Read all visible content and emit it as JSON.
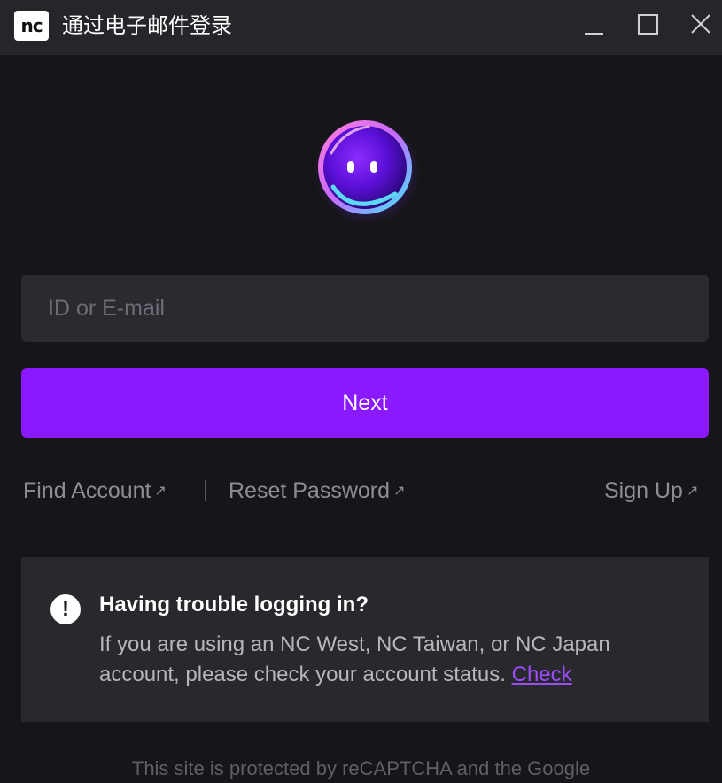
{
  "window": {
    "logo_text": "nc",
    "title": "通过电子邮件登录",
    "controls": [
      "minimize-icon",
      "maximize-icon",
      "close-icon"
    ]
  },
  "login": {
    "id_placeholder": "ID or E-mail",
    "id_value": "",
    "next_label": "Next"
  },
  "links": {
    "find_account": "Find Account",
    "reset_password": "Reset Password",
    "sign_up": "Sign Up",
    "external_arrow": "↗"
  },
  "notice": {
    "icon": "!",
    "title": "Having trouble logging in?",
    "body": "If you are using an NC West, NC Taiwan, or NC Japan account, please check your account status.",
    "check_link": "Check"
  },
  "footer": {
    "text": "This site is protected by reCAPTCHA and the Google"
  },
  "colors": {
    "background": "#161519",
    "titlebar": "#25252a",
    "accent": "#8a19ff",
    "input_bg": "#2a2a30",
    "notice_bg": "#28282d",
    "link_gray": "#8d8d96"
  }
}
